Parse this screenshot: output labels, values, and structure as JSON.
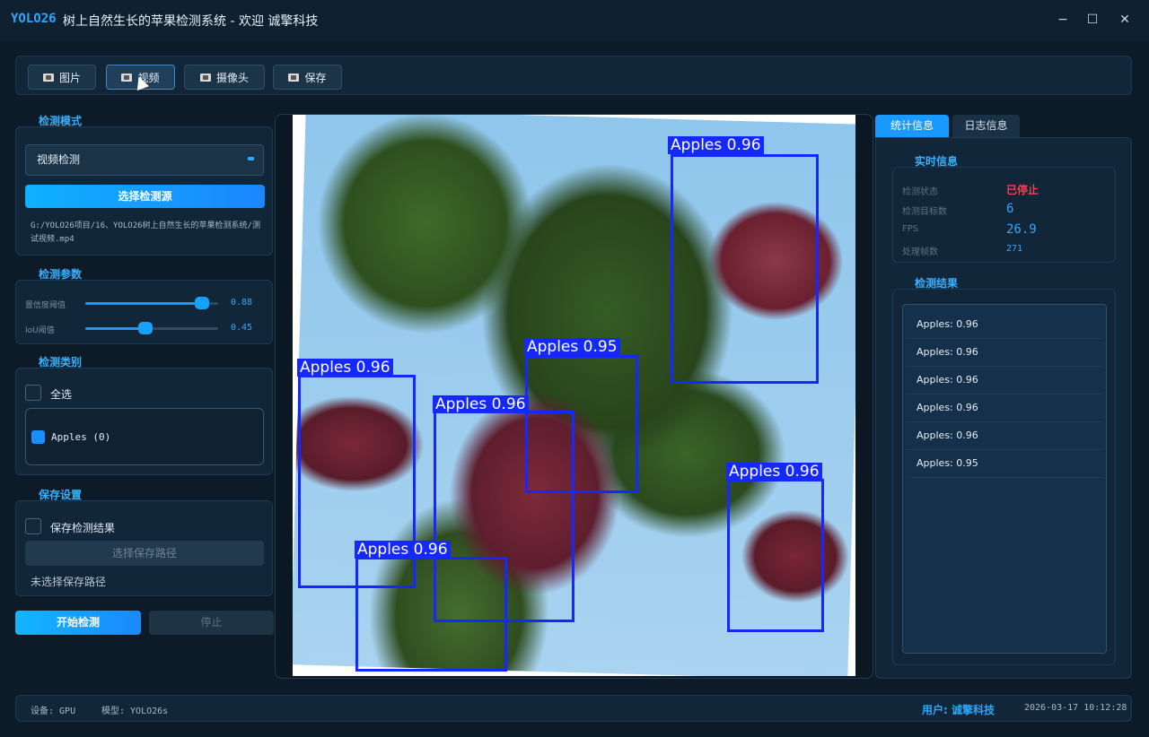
{
  "window": {
    "app_name": "YOLO26",
    "title": "树上自然生长的苹果检测系统 - 欢迎 诚擎科技",
    "minimize": "−",
    "maximize": "☐",
    "close": "✕"
  },
  "toolbar": {
    "image_label": "图片",
    "video_label": "视频",
    "camera_label": "摄像头",
    "save_label": "保存"
  },
  "left": {
    "mode_title": "检测模式",
    "mode_value": "视频检测",
    "select_source_label": "选择检测源",
    "source_path": "G:/YOLO26项目/16、YOLO26树上自然生长的苹果检测系统/测试视频.mp4",
    "params_title": "检测参数",
    "conf_label": "置信度阈值",
    "conf_value": "0.88",
    "conf_level": 0.88,
    "iou_label": "IoU阈值",
    "iou_value": "0.45",
    "iou_level": 0.45,
    "classes_title": "检测类别",
    "select_all_label": "全选",
    "class_item_label": "Apples (0)",
    "save_title": "保存设置",
    "save_result_label": "保存检测结果",
    "select_save_path_label": "选择保存路径",
    "save_path_status": "未选择保存路径",
    "start_label": "开始检测",
    "stop_label": "停止"
  },
  "detections": [
    {
      "label": "Apples 0.96"
    },
    {
      "label": "Apples 0.95"
    },
    {
      "label": "Apples 0.96"
    },
    {
      "label": "Apples 0.96"
    },
    {
      "label": "Apples 0.96"
    },
    {
      "label": "Apples 0.96"
    }
  ],
  "right": {
    "tab_stats": "统计信息",
    "tab_log": "日志信息",
    "realtime_title": "实时信息",
    "status_key": "检测状态",
    "status_value": "已停止",
    "count_key": "检测目标数",
    "count_value": "6",
    "fps_key": "FPS",
    "fps_value": "26.9",
    "frames_key": "处理帧数",
    "frames_value": "271",
    "results_title": "检测结果",
    "results": [
      "Apples: 0.96",
      "Apples: 0.96",
      "Apples: 0.96",
      "Apples: 0.96",
      "Apples: 0.96",
      "Apples: 0.95"
    ]
  },
  "status": {
    "device": "设备: GPU",
    "model": "模型: YOLO26s",
    "user": "用户: 诚擎科技",
    "datetime": "2026-03-17 10:12:28"
  },
  "colors": {
    "accent": "#2ea8ff",
    "stopped": "#ff3b4a",
    "bbox": "#1428ff"
  }
}
